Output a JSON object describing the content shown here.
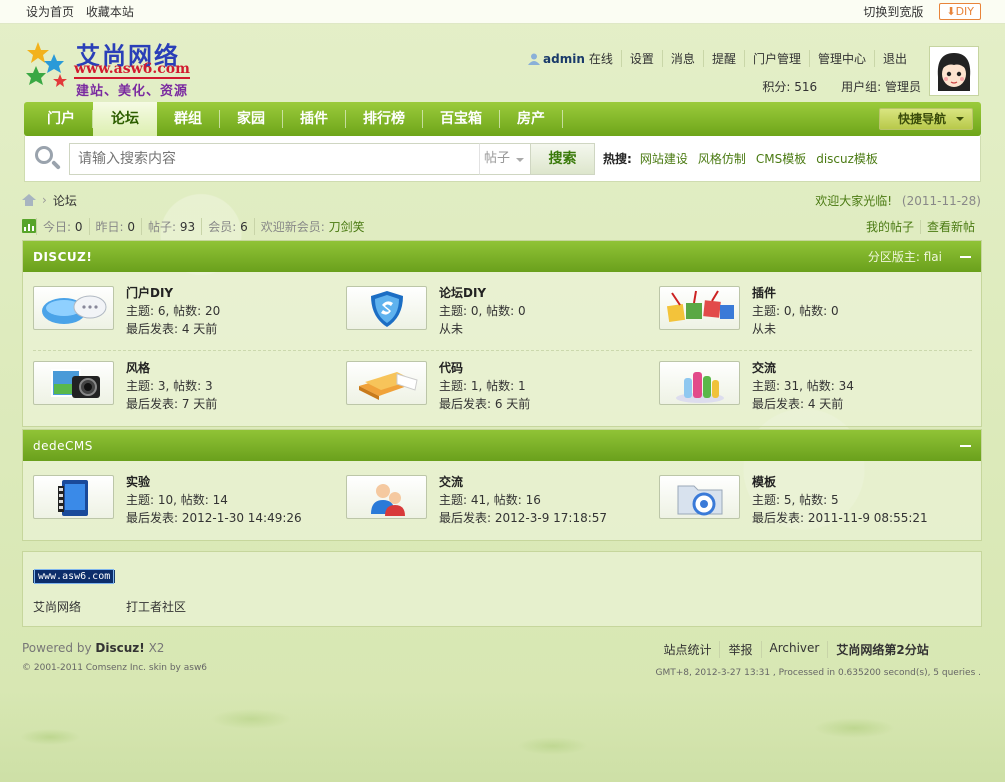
{
  "topbar": {
    "set_home": "设为首页",
    "bookmark": "收藏本站",
    "switch_width": "切换到宽版",
    "diy": "DIY"
  },
  "logo": {
    "brand": "艾尚网络",
    "url": "www.asw6.com",
    "slogan": "建站、美化、资源"
  },
  "user": {
    "name": "admin",
    "status": "在线",
    "links": [
      "设置",
      "消息",
      "提醒",
      "门户管理",
      "管理中心",
      "退出"
    ],
    "credits_label": "积分: 516",
    "group_label": "用户组: 管理员"
  },
  "nav": {
    "items": [
      "门户",
      "论坛",
      "群组",
      "家园",
      "插件",
      "排行榜",
      "百宝箱",
      "房产"
    ],
    "active_index": 1,
    "quick_nav": "快捷导航"
  },
  "search": {
    "placeholder": "请输入搜索内容",
    "type": "帖子",
    "button": "搜索",
    "hot_label": "热搜:",
    "hot_keywords": [
      "网站建设",
      "风格仿制",
      "CMS模板",
      "discuz模板"
    ]
  },
  "breadcrumb": {
    "current": "论坛",
    "welcome": "欢迎大家光临!",
    "date": "(2011-11-28)"
  },
  "stats": {
    "today_label": "今日:",
    "today": "0",
    "yesterday_label": "昨日:",
    "yesterday": "0",
    "posts_label": "帖子:",
    "posts": "93",
    "members_label": "会员:",
    "members": "6",
    "newmember_label": "欢迎新会员:",
    "newmember": "刀剑笑",
    "my_posts": "我的帖子",
    "new_posts": "查看新帖"
  },
  "sections": [
    {
      "title": "DISCUZ!",
      "moderator_label": "分区版主:",
      "moderator": "flai",
      "forums": [
        {
          "name": "门户DIY",
          "stats": "主题: 6, 帖数: 20",
          "last": "最后发表: 4 天前",
          "icon": "cloud-chat-icon"
        },
        {
          "name": "论坛DIY",
          "stats": "主题: 0, 帖数: 0",
          "last": "从未",
          "icon": "shield-icon"
        },
        {
          "name": "插件",
          "stats": "主题: 0, 帖数: 0",
          "last": "从未",
          "icon": "puzzle-icon"
        },
        {
          "name": "风格",
          "stats": "主题: 3, 帖数: 3",
          "last": "最后发表: 7 天前",
          "icon": "camera-icon"
        },
        {
          "name": "代码",
          "stats": "主题: 1, 帖数: 1",
          "last": "最后发表: 6 天前",
          "icon": "books-icon"
        },
        {
          "name": "交流",
          "stats": "主题: 31, 帖数: 34",
          "last": "最后发表: 4 天前",
          "icon": "bottles-icon"
        }
      ]
    },
    {
      "title": "dedeCMS",
      "moderator_label": "",
      "moderator": "",
      "forums": [
        {
          "name": "实验",
          "stats": "主题: 10, 帖数: 14",
          "last": "最后发表: 2012-1-30 14:49:26",
          "icon": "film-icon"
        },
        {
          "name": "交流",
          "stats": "主题: 41, 帖数: 16",
          "last": "最后发表: 2012-3-9 17:18:57",
          "icon": "users-icon"
        },
        {
          "name": "模板",
          "stats": "主题: 5, 帖数: 5",
          "last": "最后发表: 2011-11-9 08:55:21",
          "icon": "folder-icon"
        }
      ]
    }
  ],
  "links": {
    "banner": "www.asw6.com",
    "names": [
      "艾尚网络",
      "打工者社区"
    ]
  },
  "footer": {
    "powered_prefix": "Powered by",
    "powered_brand": "Discuz!",
    "powered_version": "X2",
    "copyright": "© 2001-2011 Comsenz Inc. skin by asw6",
    "links": [
      "站点统计",
      "举报",
      "Archiver",
      "艾尚网络第2分站"
    ],
    "gmt": "GMT+8, 2012-3-27 13:31 , Processed in 0.635200 second(s), 5 queries ."
  },
  "colors": {
    "nav_green": "#7db426",
    "link_green": "#4a7a12",
    "diy_orange": "#e8843a"
  }
}
